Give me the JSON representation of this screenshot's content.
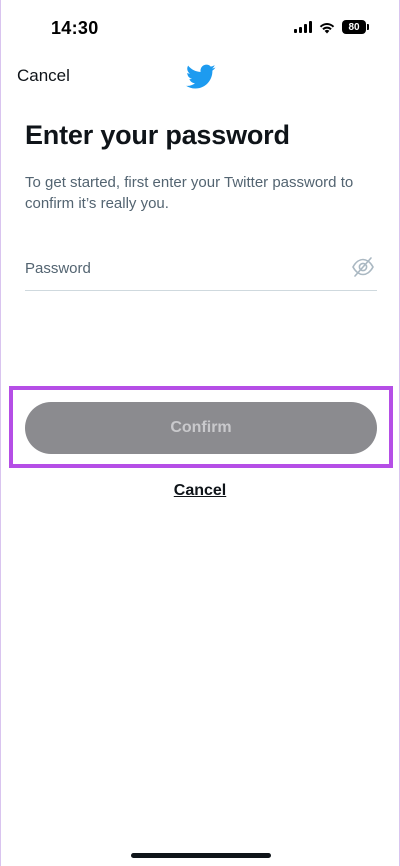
{
  "status_bar": {
    "time": "14:30",
    "battery": "80"
  },
  "nav": {
    "cancel_label": "Cancel",
    "logo_icon": "twitter-bird-icon",
    "brand_color": "#1d9bf0"
  },
  "main": {
    "title": "Enter your password",
    "subtitle": "To get started, first enter your Twitter password to confirm it’s really you.",
    "password_field": {
      "placeholder": "Password",
      "value": "",
      "toggle_icon": "eye-off-icon"
    },
    "confirm_label": "Confirm",
    "cancel_label": "Cancel"
  },
  "colors": {
    "highlight": "#b54ee6",
    "confirm_disabled_bg": "#8b8b8f"
  }
}
